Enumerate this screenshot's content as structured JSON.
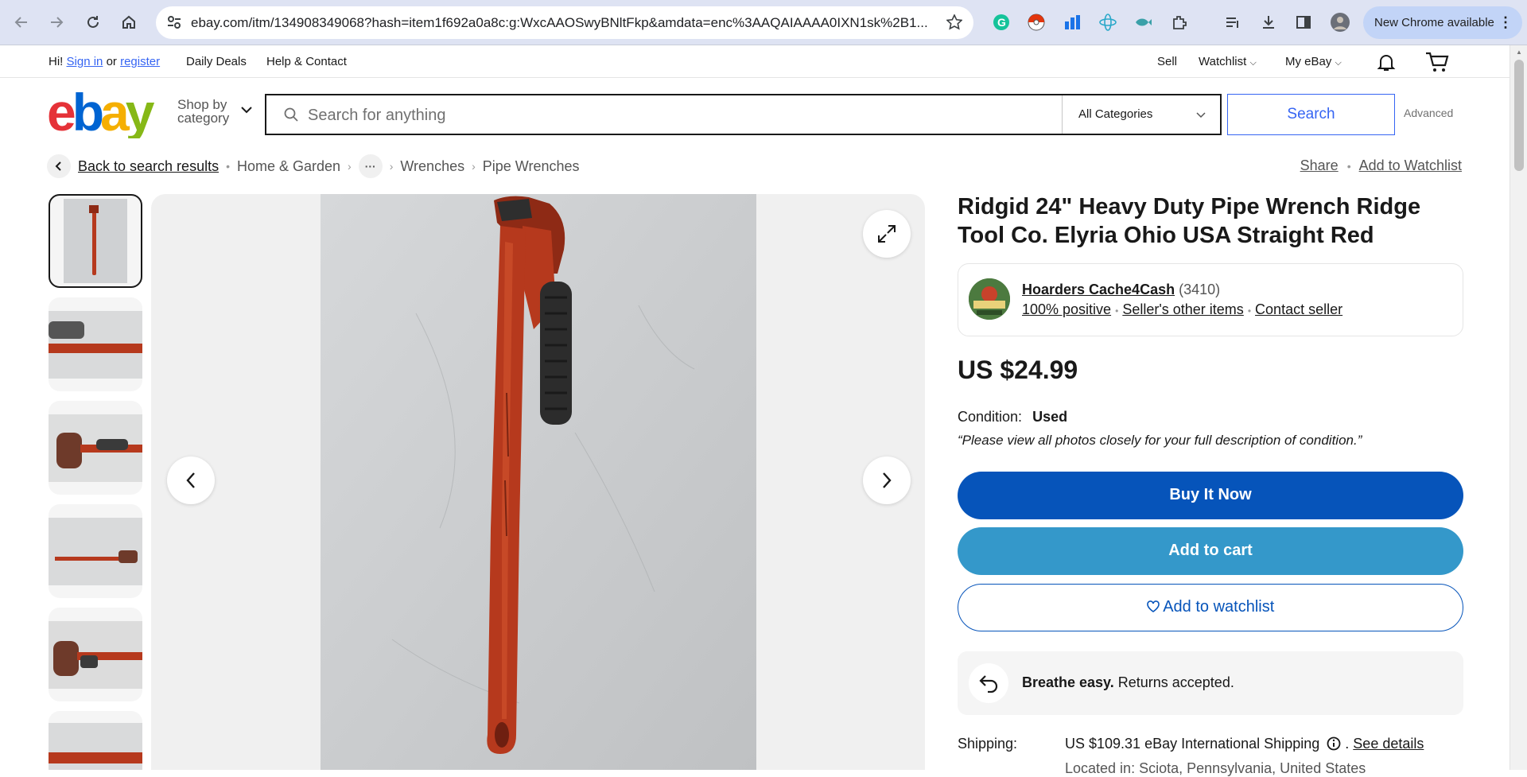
{
  "browser": {
    "url": "ebay.com/itm/134908349068?hash=item1f692a0a8c:g:WxcAAOSwyBNltFkp&amdata=enc%3AAQAIAAAA0IXN1sk%2B1...",
    "update_label": "New Chrome available"
  },
  "topnav": {
    "greeting": "Hi!",
    "sign_in": "Sign in",
    "or": "or",
    "register": "register",
    "daily_deals": "Daily Deals",
    "help": "Help & Contact",
    "sell": "Sell",
    "watchlist": "Watchlist",
    "my_ebay": "My eBay"
  },
  "header": {
    "shop_by": "Shop by",
    "category": "category",
    "search_placeholder": "Search for anything",
    "category_select": "All Categories",
    "search_button": "Search",
    "advanced": "Advanced"
  },
  "breadcrumb": {
    "back": "Back to search results",
    "items": [
      "Home & Garden",
      "Wrenches",
      "Pipe Wrenches"
    ],
    "share": "Share",
    "add_watchlist": "Add to Watchlist"
  },
  "item": {
    "title": "Ridgid 24\" Heavy Duty Pipe Wrench Ridge Tool Co. Elyria Ohio USA Straight Red",
    "seller_name": "Hoarders Cache4Cash",
    "seller_feedback": "(3410)",
    "seller_positive": "100% positive",
    "seller_other": "Seller's other items",
    "contact_seller": "Contact seller",
    "price": "US $24.99",
    "condition_label": "Condition:",
    "condition_value": "Used",
    "condition_note": "“Please view all photos closely for your full description of condition.”",
    "buy_now": "Buy It Now",
    "add_to_cart": "Add to cart",
    "add_to_watchlist": "Add to watchlist",
    "returns_bold": "Breathe easy.",
    "returns_text": "Returns accepted.",
    "shipping_label": "Shipping:",
    "shipping_value": "US $109.31 eBay International Shipping",
    "see_details": "See details",
    "location": "Located in: Sciota, Pennsylvania, United States"
  },
  "colors": {
    "ebay_blue": "#0654ba",
    "cart_blue": "#3498ca",
    "link_blue": "#3665f3",
    "wrench_red": "#b6391d"
  }
}
